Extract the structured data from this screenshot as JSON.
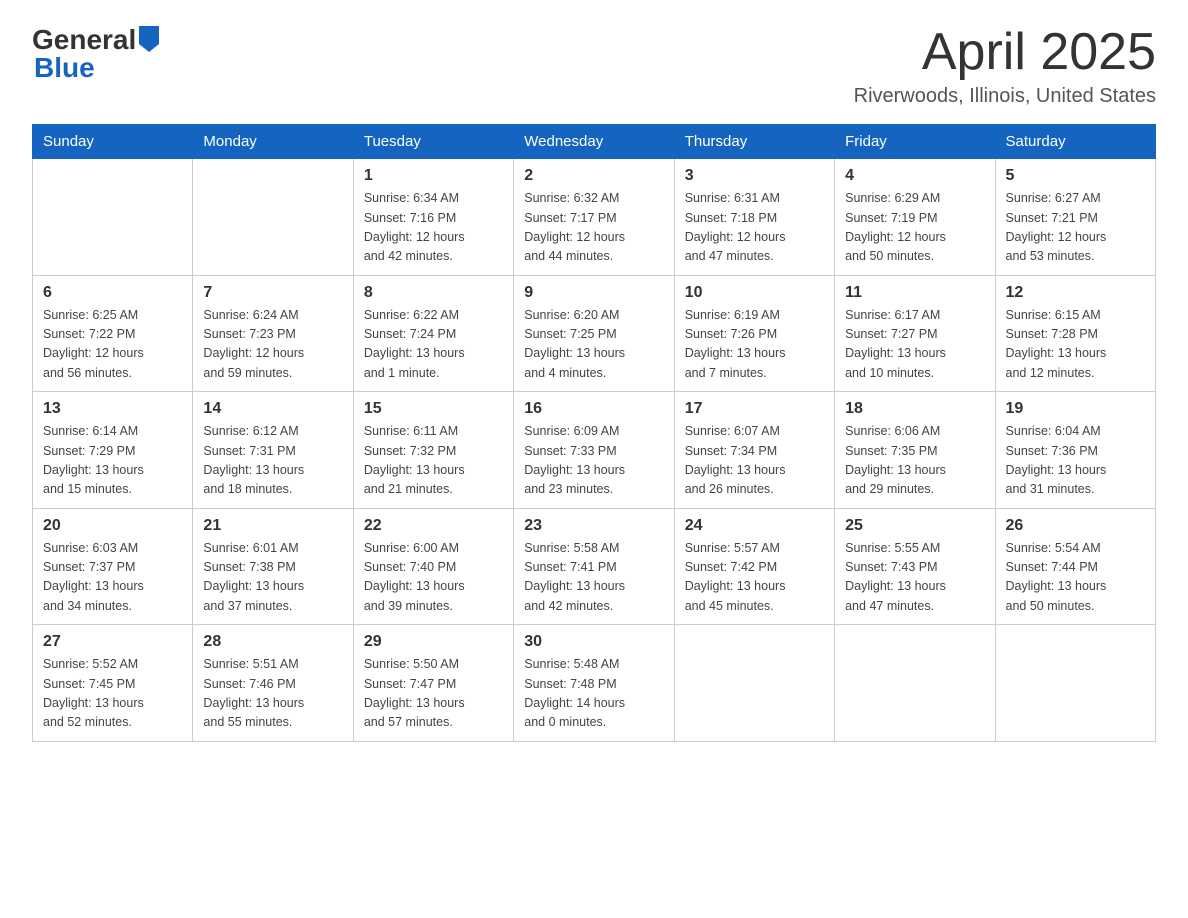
{
  "header": {
    "logo_general": "General",
    "logo_blue": "Blue",
    "title": "April 2025",
    "location": "Riverwoods, Illinois, United States"
  },
  "weekdays": [
    "Sunday",
    "Monday",
    "Tuesday",
    "Wednesday",
    "Thursday",
    "Friday",
    "Saturday"
  ],
  "weeks": [
    [
      {
        "day": "",
        "info": ""
      },
      {
        "day": "",
        "info": ""
      },
      {
        "day": "1",
        "info": "Sunrise: 6:34 AM\nSunset: 7:16 PM\nDaylight: 12 hours\nand 42 minutes."
      },
      {
        "day": "2",
        "info": "Sunrise: 6:32 AM\nSunset: 7:17 PM\nDaylight: 12 hours\nand 44 minutes."
      },
      {
        "day": "3",
        "info": "Sunrise: 6:31 AM\nSunset: 7:18 PM\nDaylight: 12 hours\nand 47 minutes."
      },
      {
        "day": "4",
        "info": "Sunrise: 6:29 AM\nSunset: 7:19 PM\nDaylight: 12 hours\nand 50 minutes."
      },
      {
        "day": "5",
        "info": "Sunrise: 6:27 AM\nSunset: 7:21 PM\nDaylight: 12 hours\nand 53 minutes."
      }
    ],
    [
      {
        "day": "6",
        "info": "Sunrise: 6:25 AM\nSunset: 7:22 PM\nDaylight: 12 hours\nand 56 minutes."
      },
      {
        "day": "7",
        "info": "Sunrise: 6:24 AM\nSunset: 7:23 PM\nDaylight: 12 hours\nand 59 minutes."
      },
      {
        "day": "8",
        "info": "Sunrise: 6:22 AM\nSunset: 7:24 PM\nDaylight: 13 hours\nand 1 minute."
      },
      {
        "day": "9",
        "info": "Sunrise: 6:20 AM\nSunset: 7:25 PM\nDaylight: 13 hours\nand 4 minutes."
      },
      {
        "day": "10",
        "info": "Sunrise: 6:19 AM\nSunset: 7:26 PM\nDaylight: 13 hours\nand 7 minutes."
      },
      {
        "day": "11",
        "info": "Sunrise: 6:17 AM\nSunset: 7:27 PM\nDaylight: 13 hours\nand 10 minutes."
      },
      {
        "day": "12",
        "info": "Sunrise: 6:15 AM\nSunset: 7:28 PM\nDaylight: 13 hours\nand 12 minutes."
      }
    ],
    [
      {
        "day": "13",
        "info": "Sunrise: 6:14 AM\nSunset: 7:29 PM\nDaylight: 13 hours\nand 15 minutes."
      },
      {
        "day": "14",
        "info": "Sunrise: 6:12 AM\nSunset: 7:31 PM\nDaylight: 13 hours\nand 18 minutes."
      },
      {
        "day": "15",
        "info": "Sunrise: 6:11 AM\nSunset: 7:32 PM\nDaylight: 13 hours\nand 21 minutes."
      },
      {
        "day": "16",
        "info": "Sunrise: 6:09 AM\nSunset: 7:33 PM\nDaylight: 13 hours\nand 23 minutes."
      },
      {
        "day": "17",
        "info": "Sunrise: 6:07 AM\nSunset: 7:34 PM\nDaylight: 13 hours\nand 26 minutes."
      },
      {
        "day": "18",
        "info": "Sunrise: 6:06 AM\nSunset: 7:35 PM\nDaylight: 13 hours\nand 29 minutes."
      },
      {
        "day": "19",
        "info": "Sunrise: 6:04 AM\nSunset: 7:36 PM\nDaylight: 13 hours\nand 31 minutes."
      }
    ],
    [
      {
        "day": "20",
        "info": "Sunrise: 6:03 AM\nSunset: 7:37 PM\nDaylight: 13 hours\nand 34 minutes."
      },
      {
        "day": "21",
        "info": "Sunrise: 6:01 AM\nSunset: 7:38 PM\nDaylight: 13 hours\nand 37 minutes."
      },
      {
        "day": "22",
        "info": "Sunrise: 6:00 AM\nSunset: 7:40 PM\nDaylight: 13 hours\nand 39 minutes."
      },
      {
        "day": "23",
        "info": "Sunrise: 5:58 AM\nSunset: 7:41 PM\nDaylight: 13 hours\nand 42 minutes."
      },
      {
        "day": "24",
        "info": "Sunrise: 5:57 AM\nSunset: 7:42 PM\nDaylight: 13 hours\nand 45 minutes."
      },
      {
        "day": "25",
        "info": "Sunrise: 5:55 AM\nSunset: 7:43 PM\nDaylight: 13 hours\nand 47 minutes."
      },
      {
        "day": "26",
        "info": "Sunrise: 5:54 AM\nSunset: 7:44 PM\nDaylight: 13 hours\nand 50 minutes."
      }
    ],
    [
      {
        "day": "27",
        "info": "Sunrise: 5:52 AM\nSunset: 7:45 PM\nDaylight: 13 hours\nand 52 minutes."
      },
      {
        "day": "28",
        "info": "Sunrise: 5:51 AM\nSunset: 7:46 PM\nDaylight: 13 hours\nand 55 minutes."
      },
      {
        "day": "29",
        "info": "Sunrise: 5:50 AM\nSunset: 7:47 PM\nDaylight: 13 hours\nand 57 minutes."
      },
      {
        "day": "30",
        "info": "Sunrise: 5:48 AM\nSunset: 7:48 PM\nDaylight: 14 hours\nand 0 minutes."
      },
      {
        "day": "",
        "info": ""
      },
      {
        "day": "",
        "info": ""
      },
      {
        "day": "",
        "info": ""
      }
    ]
  ]
}
